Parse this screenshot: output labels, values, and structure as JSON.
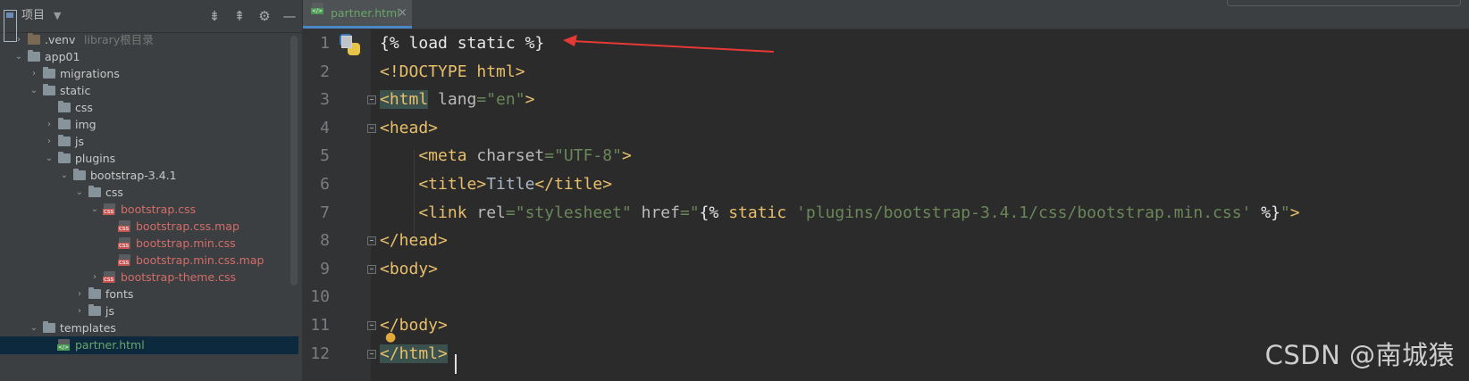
{
  "project_panel": {
    "title": "项目",
    "icons": [
      "expand-all-icon",
      "collapse-all-icon",
      "gear-icon",
      "minimize-icon"
    ],
    "tree": [
      {
        "label": ".venv",
        "hint": "library根目录",
        "kind": "folder-excluded",
        "arrow": "›",
        "level": 1
      },
      {
        "label": "app01",
        "kind": "folder",
        "arrow": "⌄",
        "level": 1
      },
      {
        "label": "migrations",
        "kind": "folder",
        "arrow": "›",
        "level": 2
      },
      {
        "label": "static",
        "kind": "folder",
        "arrow": "⌄",
        "level": 2
      },
      {
        "label": "css",
        "kind": "folder",
        "arrow": "",
        "level": 3
      },
      {
        "label": "img",
        "kind": "folder",
        "arrow": "›",
        "level": 3
      },
      {
        "label": "js",
        "kind": "folder",
        "arrow": "›",
        "level": 3
      },
      {
        "label": "plugins",
        "kind": "folder",
        "arrow": "⌄",
        "level": 3
      },
      {
        "label": "bootstrap-3.4.1",
        "kind": "folder",
        "arrow": "⌄",
        "level": 4
      },
      {
        "label": "css",
        "kind": "folder",
        "arrow": "⌄",
        "level": 5
      },
      {
        "label": "bootstrap.css",
        "kind": "css",
        "arrow": "⌄",
        "level": 6
      },
      {
        "label": "bootstrap.css.map",
        "kind": "css",
        "arrow": "",
        "level": 7
      },
      {
        "label": "bootstrap.min.css",
        "kind": "css",
        "arrow": "",
        "level": 7
      },
      {
        "label": "bootstrap.min.css.map",
        "kind": "css",
        "arrow": "",
        "level": 7
      },
      {
        "label": "bootstrap-theme.css",
        "kind": "css",
        "arrow": "›",
        "level": 6
      },
      {
        "label": "fonts",
        "kind": "folder",
        "arrow": "›",
        "level": 5
      },
      {
        "label": "js",
        "kind": "folder",
        "arrow": "›",
        "level": 5
      },
      {
        "label": "templates",
        "kind": "folder",
        "arrow": "⌄",
        "level": 2
      },
      {
        "label": "partner.html",
        "kind": "html",
        "arrow": "",
        "level": 3,
        "selected": true
      }
    ]
  },
  "editor": {
    "tab": {
      "label": "partner.html",
      "close": "×"
    },
    "line_numbers": [
      "1",
      "2",
      "3",
      "4",
      "5",
      "6",
      "7",
      "8",
      "9",
      "10",
      "11",
      "12"
    ],
    "lines": [
      [
        {
          "t": "{% ",
          "c": "t-tpl"
        },
        {
          "t": "load static",
          "c": "t-tpl"
        },
        {
          "t": " %}",
          "c": "t-tpl"
        }
      ],
      [
        {
          "t": "<!DOCTYPE html>",
          "c": "t-tag"
        }
      ],
      [
        {
          "t": "<html",
          "c": "t-tag hl-tag"
        },
        {
          "t": " lang",
          "c": "t-attr"
        },
        {
          "t": "=\"en\"",
          "c": "t-str"
        },
        {
          "t": ">",
          "c": "t-tag"
        }
      ],
      [
        {
          "t": "<head>",
          "c": "t-tag"
        }
      ],
      [
        {
          "t": "    <meta",
          "c": "t-tag"
        },
        {
          "t": " charset",
          "c": "t-attr"
        },
        {
          "t": "=\"UTF-8\"",
          "c": "t-str"
        },
        {
          "t": ">",
          "c": "t-tag"
        }
      ],
      [
        {
          "t": "    <title>",
          "c": "t-tag"
        },
        {
          "t": "Title",
          "c": "t-plain"
        },
        {
          "t": "</title>",
          "c": "t-tag"
        }
      ],
      [
        {
          "t": "    <link",
          "c": "t-tag"
        },
        {
          "t": " rel",
          "c": "t-attr"
        },
        {
          "t": "=\"stylesheet\"",
          "c": "t-str"
        },
        {
          "t": " href",
          "c": "t-attr"
        },
        {
          "t": "=\"",
          "c": "t-str"
        },
        {
          "t": "{% ",
          "c": "t-tpl"
        },
        {
          "t": "static",
          "c": "t-tag"
        },
        {
          "t": " 'plugins/bootstrap-3.4.1/css/bootstrap.min.css'",
          "c": "t-str"
        },
        {
          "t": " %}",
          "c": "t-tpl"
        },
        {
          "t": "\"",
          "c": "t-str"
        },
        {
          "t": ">",
          "c": "t-tag"
        }
      ],
      [
        {
          "t": "</head>",
          "c": "t-tag"
        }
      ],
      [
        {
          "t": "<body>",
          "c": "t-tag"
        }
      ],
      [],
      [
        {
          "t": "</body>",
          "c": "t-tag"
        }
      ],
      [
        {
          "t": "</html>",
          "c": "t-tag hl-tag"
        }
      ]
    ]
  },
  "watermark": "CSDN @南城猿"
}
